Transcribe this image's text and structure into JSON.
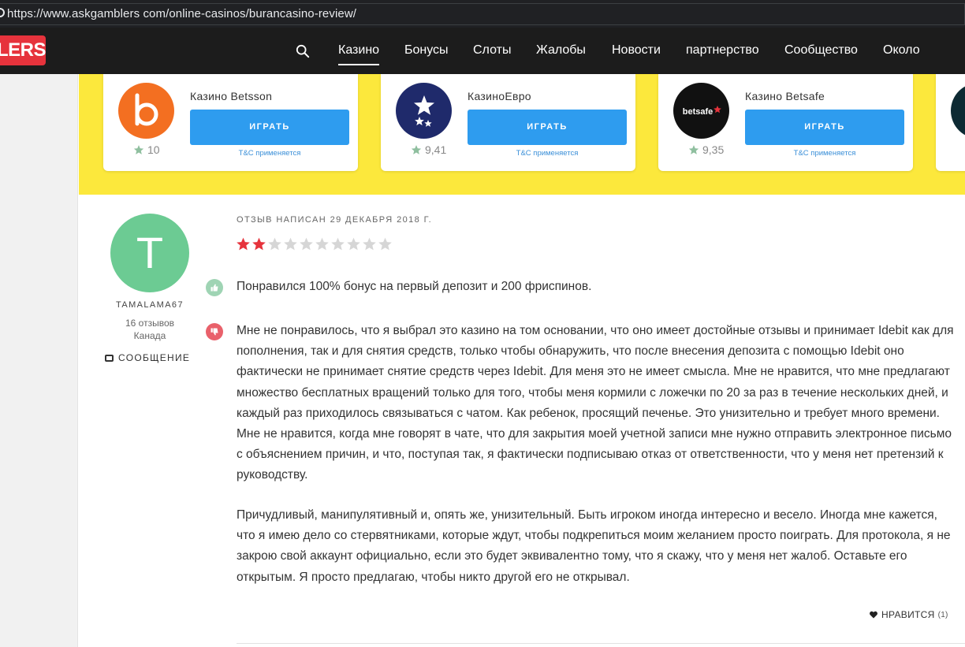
{
  "browser": {
    "url": "https://www.askgamblers com/online-casinos/burancasino-review/"
  },
  "header": {
    "logo_text": "LERS",
    "nav": [
      "Казино",
      "Бонусы",
      "Слоты",
      "Жалобы",
      "Новости",
      "партнерство",
      "Сообщество",
      "Около"
    ],
    "active_nav": "Казино"
  },
  "casinos": [
    {
      "name": "Казино Betsson",
      "logo_text": "b",
      "logo_color": "#f36f21",
      "play_label": "ИГРАТЬ",
      "rating": "10",
      "tc": "T&C применяется"
    },
    {
      "name": "КазиноЕвро",
      "logo_text": "",
      "logo_color": "#1f2a6b",
      "play_label": "ИГРАТЬ",
      "rating": "9,41",
      "tc": "T&C применяется"
    },
    {
      "name": "Казино Betsafe",
      "logo_text": "betsafe",
      "logo_color": "#111111",
      "play_label": "ИГРАТЬ",
      "rating": "9,35",
      "tc": "T&C применяется"
    }
  ],
  "review": {
    "avatar_letter": "T",
    "avatar_color": "#6ccb93",
    "username": "TAMALAMA67",
    "reviews_count": "16 отзывов",
    "country": "Канада",
    "message_label": "СООБЩЕНИЕ",
    "written_label": "ОТЗЫВ НАПИСАН",
    "written_date": "29 ДЕКАБРЯ 2018 Г.",
    "rating": 2,
    "rating_max": 10,
    "pro_text": "Понравился 100% бонус на первый депозит и 200 фриспинов.",
    "con_text": "Мне не понравилось, что я выбрал это казино на том основании, что оно имеет достойные отзывы и принимает Idebit как для пополнения, так и для снятия средств, только чтобы обнаружить, что после внесения депозита с помощью Idebit оно фактически не принимает снятие средств через Idebit. Для меня это не имеет смысла. Мне не нравится, что мне предлагают множество бесплатных вращений только для того, чтобы меня кормили с ложечки по 20 за раз в течение нескольких дней, и каждый раз приходилось связываться с чатом. Как ребенок, просящий печенье. Это унизительно и требует много времени. Мне не нравится, когда мне говорят в чате, что для закрытия моей учетной записи мне нужно отправить электронное письмо с объяснением причин, и что, поступая так, я фактически подписываю отказ от ответственности, что у меня нет претензий к руководству.",
    "more_text": "Причудливый, манипулятивный и, опять же, унизительный. Быть игроком иногда интересно и весело. Иногда мне кажется, что я имею дело со стервятниками, которые ждут, чтобы подкрепиться моим желанием просто поиграть. Для протокола, я не закрою свой аккаунт официально, если это будет эквивалентно тому, что я скажу, что у меня нет жалоб. Оставьте его открытым. Я просто предлагаю, чтобы никто другой его не открывал.",
    "like_label": "НРАВИТСЯ",
    "like_count": "(1)"
  },
  "colors": {
    "star_active": "#e6333c",
    "star_inactive": "#d6d6d6",
    "accent_blue": "#2e9cef",
    "yellow": "#fce83c"
  }
}
